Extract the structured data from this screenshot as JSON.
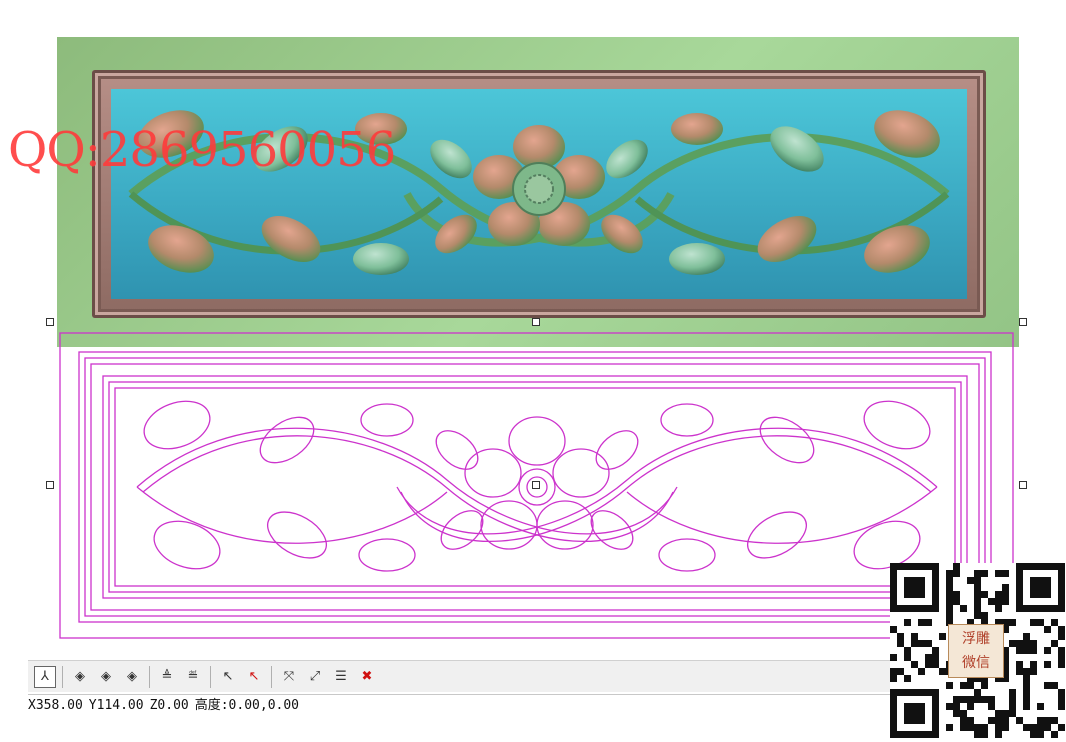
{
  "watermark": {
    "text": "QQ:2869560056"
  },
  "toolbar": {
    "buttons": [
      {
        "name": "axis-tool-button",
        "glyph": "⅄",
        "active": true
      },
      {
        "name": "node-edit-button-1",
        "glyph": "◈"
      },
      {
        "name": "node-edit-button-2",
        "glyph": "◈"
      },
      {
        "name": "node-edit-button-3",
        "glyph": "◈"
      },
      {
        "name": "layer-button-1",
        "glyph": "≜"
      },
      {
        "name": "layer-button-2",
        "glyph": "≝"
      },
      {
        "name": "select-arrow-button",
        "glyph": "↖"
      },
      {
        "name": "deselect-arrow-button",
        "glyph": "↖"
      },
      {
        "name": "transform-button",
        "glyph": "⤧"
      },
      {
        "name": "measure-button",
        "glyph": "⤢"
      },
      {
        "name": "edit-list-button",
        "glyph": "☰"
      },
      {
        "name": "delete-button",
        "glyph": "✖"
      }
    ]
  },
  "status": {
    "x": "X358.00",
    "y": "Y114.00",
    "z": "Z0.00",
    "height": "高度:0.00,0.00"
  },
  "qr_badge": {
    "line1": "浮雕",
    "line2": "微信"
  },
  "colors": {
    "vector_stroke": "#cc33cc",
    "relief_field": "#3aa7c1",
    "relief_frame": "#9c776f",
    "watermark": "#ff3b3b",
    "delete_icon": "#d01010"
  }
}
